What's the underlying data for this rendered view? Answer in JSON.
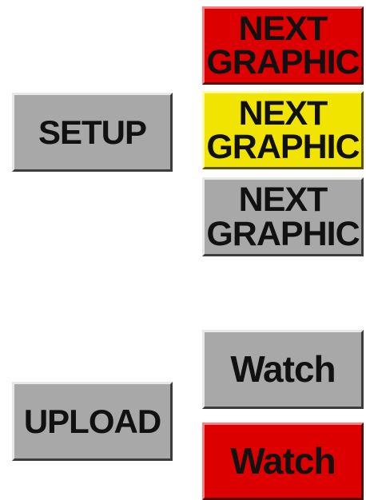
{
  "buttons": {
    "setup": {
      "label": "SETUP",
      "color": "#a8a8a8"
    },
    "upload": {
      "label": "UPLOAD",
      "color": "#a8a8a8"
    },
    "next_graphic_red": {
      "line1": "NEXT",
      "line2": "GRAPHIC",
      "color": "#dc0000"
    },
    "next_graphic_yellow": {
      "line1": "NEXT",
      "line2": "GRAPHIC",
      "color": "#f0e400"
    },
    "next_graphic_gray": {
      "line1": "NEXT",
      "line2": "GRAPHIC",
      "color": "#a8a8a8"
    },
    "watch_gray": {
      "label": "Watch",
      "color": "#a8a8a8"
    },
    "watch_red": {
      "label": "Watch",
      "color": "#dc0000"
    }
  }
}
